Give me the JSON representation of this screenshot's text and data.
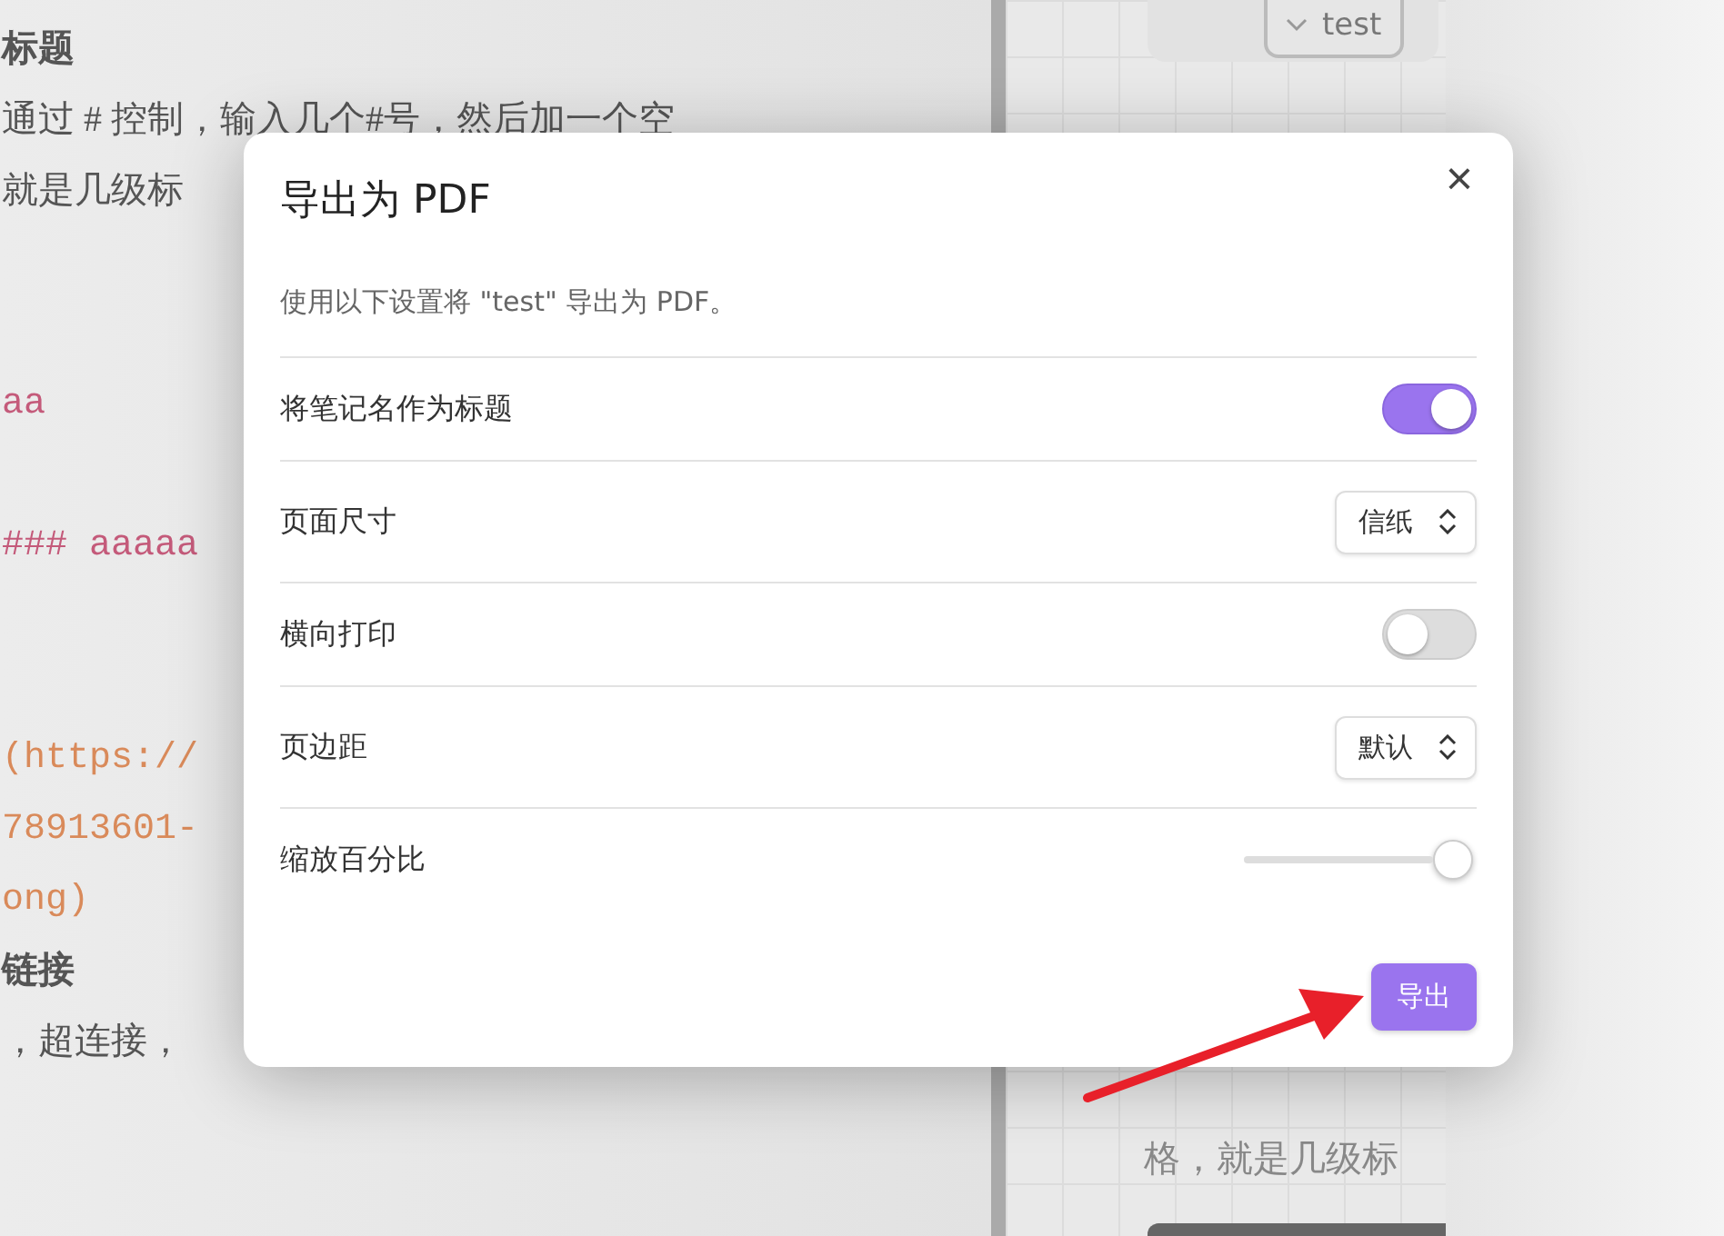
{
  "editor": {
    "lines": [
      {
        "kind": "heading",
        "text": "标题"
      },
      {
        "kind": "body",
        "text": "通过 # 控制，输入几个#号，然后加一个空"
      },
      {
        "kind": "body",
        "text": "就是几级标"
      },
      {
        "kind": "code",
        "color": "#c45a7a",
        "text": "aa"
      },
      {
        "kind": "code",
        "color": "#c45a7a",
        "text": "### aaaaa"
      },
      {
        "kind": "code",
        "color": "#d98a5a",
        "text": "(https://"
      },
      {
        "kind": "code",
        "color": "#d98a5a",
        "text": "78913601-"
      },
      {
        "kind": "code",
        "color": "#d98a5a",
        "text": "ong)"
      },
      {
        "kind": "heading",
        "text": "链接"
      },
      {
        "kind": "body",
        "text": "，超连接，"
      }
    ]
  },
  "preview": {
    "tab": "test",
    "text": "格，就是几级标"
  },
  "dialog": {
    "title": "导出为 PDF",
    "close": "×",
    "description": "使用以下设置将 \"test\" 导出为 PDF。",
    "settings": [
      {
        "kind": "toggle",
        "label": "将笔记名作为标题",
        "on": true
      },
      {
        "kind": "select",
        "label": "页面尺寸",
        "value": "信纸"
      },
      {
        "kind": "toggle",
        "label": "横向打印",
        "on": false
      },
      {
        "kind": "select",
        "label": "页边距",
        "value": "默认"
      },
      {
        "kind": "slider",
        "label": "缩放百分比",
        "level": 1
      }
    ],
    "button": "导出"
  }
}
